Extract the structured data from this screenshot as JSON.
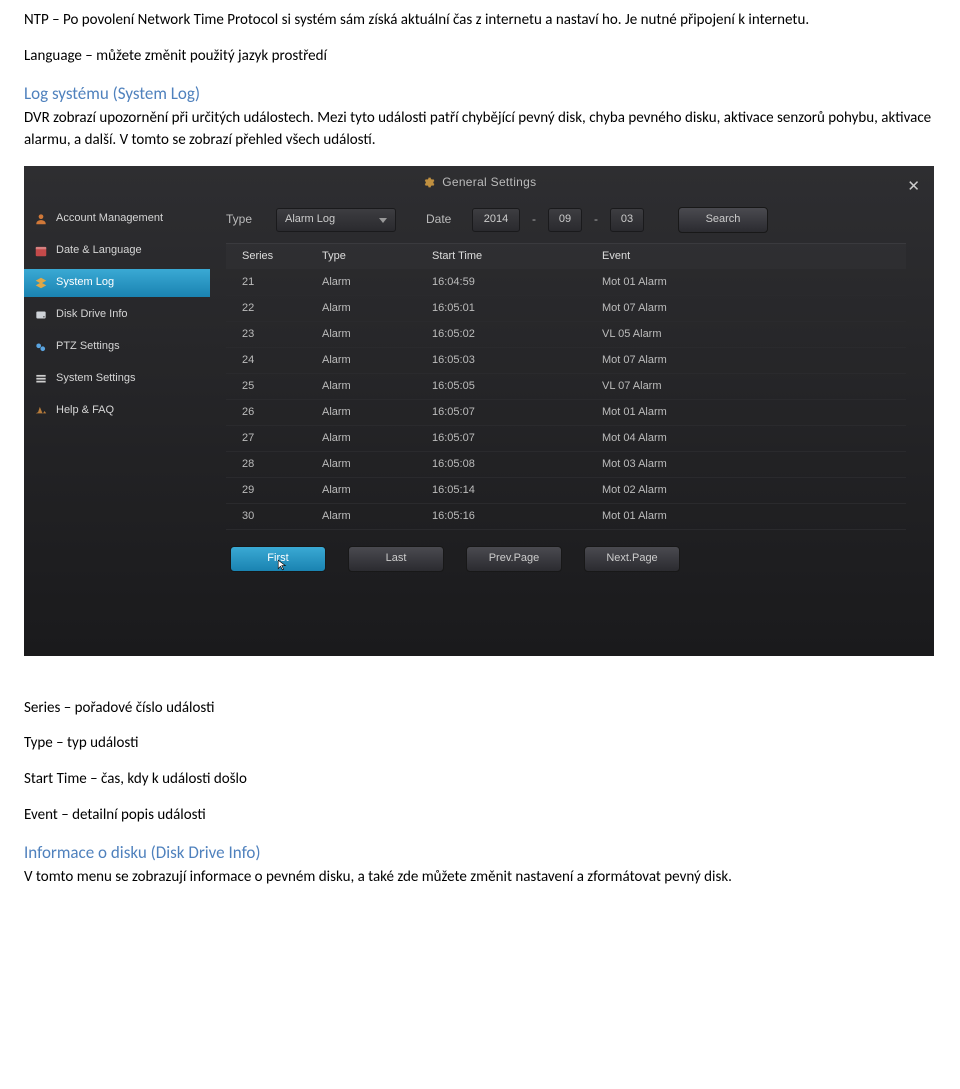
{
  "doc": {
    "p1": "NTP – Po povolení Network Time Protocol si systém sám získá aktuální čas z internetu a nastaví ho. Je nutné připojení k internetu.",
    "p2": "Language – můžete změnit použitý jazyk prostředí",
    "h1": "Log systému (System Log)",
    "p3": "DVR zobrazí upozornění při určitých událostech. Mezi tyto události patří chybějící pevný disk, chyba pevného disku, aktivace senzorů pohybu, aktivace alarmu, a další. V tomto se zobrazí přehled všech událostí.",
    "p4": "Series – pořadové číslo události",
    "p5": "Type – typ události",
    "p6": "Start Time – čas, kdy k události došlo",
    "p7": "Event – detailní popis události",
    "h2": "Informace o disku (Disk Drive Info)",
    "p8": "V tomto menu se zobrazují informace o pevném disku, a také zde můžete změnit nastavení a zformátovat pevný disk."
  },
  "ui": {
    "title": "General Settings",
    "sidebar": [
      {
        "label": "Account Management",
        "icon": "user"
      },
      {
        "label": "Date & Language",
        "icon": "calendar"
      },
      {
        "label": "System Log",
        "icon": "layers",
        "active": true
      },
      {
        "label": "Disk Drive Info",
        "icon": "disk"
      },
      {
        "label": "PTZ Settings",
        "icon": "ptz"
      },
      {
        "label": "System Settings",
        "icon": "list"
      },
      {
        "label": "Help & FAQ",
        "icon": "help"
      }
    ],
    "filter": {
      "type_label": "Type",
      "type_value": "Alarm Log",
      "date_label": "Date",
      "date_year": "2014",
      "date_month": "09",
      "date_day": "03",
      "search_label": "Search"
    },
    "columns": {
      "c0": "Series",
      "c1": "Type",
      "c2": "Start Time",
      "c3": "Event"
    },
    "rows": [
      {
        "series": "21",
        "type": "Alarm",
        "start": "16:04:59",
        "event": "Mot 01 Alarm"
      },
      {
        "series": "22",
        "type": "Alarm",
        "start": "16:05:01",
        "event": "Mot 07 Alarm"
      },
      {
        "series": "23",
        "type": "Alarm",
        "start": "16:05:02",
        "event": "VL 05 Alarm"
      },
      {
        "series": "24",
        "type": "Alarm",
        "start": "16:05:03",
        "event": "Mot 07 Alarm"
      },
      {
        "series": "25",
        "type": "Alarm",
        "start": "16:05:05",
        "event": "VL 07 Alarm"
      },
      {
        "series": "26",
        "type": "Alarm",
        "start": "16:05:07",
        "event": "Mot 01 Alarm"
      },
      {
        "series": "27",
        "type": "Alarm",
        "start": "16:05:07",
        "event": "Mot 04 Alarm"
      },
      {
        "series": "28",
        "type": "Alarm",
        "start": "16:05:08",
        "event": "Mot 03 Alarm"
      },
      {
        "series": "29",
        "type": "Alarm",
        "start": "16:05:14",
        "event": "Mot 02 Alarm"
      },
      {
        "series": "30",
        "type": "Alarm",
        "start": "16:05:16",
        "event": "Mot 01 Alarm"
      }
    ],
    "pager": {
      "first": "First",
      "last": "Last",
      "prev": "Prev.Page",
      "next": "Next.Page"
    }
  }
}
